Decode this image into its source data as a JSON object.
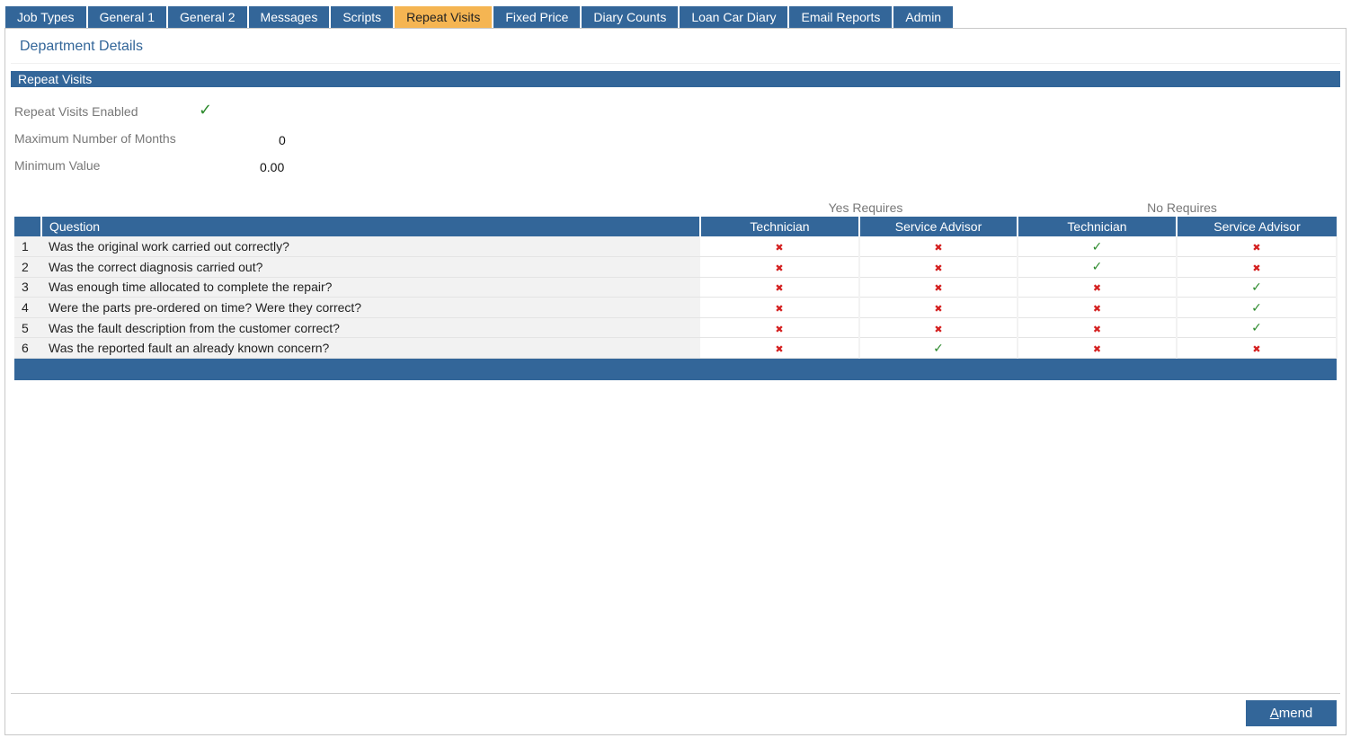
{
  "tabs": [
    {
      "label": "Job Types",
      "active": false
    },
    {
      "label": "General 1",
      "active": false
    },
    {
      "label": "General 2",
      "active": false
    },
    {
      "label": "Messages",
      "active": false
    },
    {
      "label": "Scripts",
      "active": false
    },
    {
      "label": "Repeat Visits",
      "active": true
    },
    {
      "label": "Fixed Price",
      "active": false
    },
    {
      "label": "Diary Counts",
      "active": false
    },
    {
      "label": "Loan Car Diary",
      "active": false
    },
    {
      "label": "Email Reports",
      "active": false
    },
    {
      "label": "Admin",
      "active": false
    }
  ],
  "department_title": "Department Details",
  "section_title": "Repeat Visits",
  "fields": {
    "enabled_label": "Repeat Visits Enabled",
    "enabled_icon": "check-icon",
    "max_months_label": "Maximum Number of Months",
    "max_months_value": "0",
    "min_value_label": "Minimum Value",
    "min_value_value": "0.00"
  },
  "table": {
    "group_yes": "Yes Requires",
    "group_no": "No Requires",
    "headers": {
      "question": "Question",
      "yes_technician": "Technician",
      "yes_service_advisor": "Service Advisor",
      "no_technician": "Technician",
      "no_service_advisor": "Service Advisor"
    },
    "rows": [
      {
        "num": "1",
        "question": "Was the original work carried out correctly?",
        "marks": [
          "x",
          "x",
          "ok",
          "x"
        ]
      },
      {
        "num": "2",
        "question": "Was the correct diagnosis carried out?",
        "marks": [
          "x",
          "x",
          "ok",
          "x"
        ]
      },
      {
        "num": "3",
        "question": "Was enough time allocated to complete the repair?",
        "marks": [
          "x",
          "x",
          "x",
          "ok"
        ]
      },
      {
        "num": "4",
        "question": "Were the parts pre-ordered on time? Were they correct?",
        "marks": [
          "x",
          "x",
          "x",
          "ok"
        ]
      },
      {
        "num": "5",
        "question": "Was the fault description from the customer correct?",
        "marks": [
          "x",
          "x",
          "x",
          "ok"
        ]
      },
      {
        "num": "6",
        "question": "Was the reported fault an already known concern?",
        "marks": [
          "x",
          "ok",
          "x",
          "x"
        ]
      }
    ]
  },
  "amend": {
    "accel": "A",
    "rest": "mend"
  },
  "colors": {
    "primary": "#336699",
    "active_tab": "#f5b552",
    "check": "#2c8a2c",
    "cross": "#d42020"
  }
}
